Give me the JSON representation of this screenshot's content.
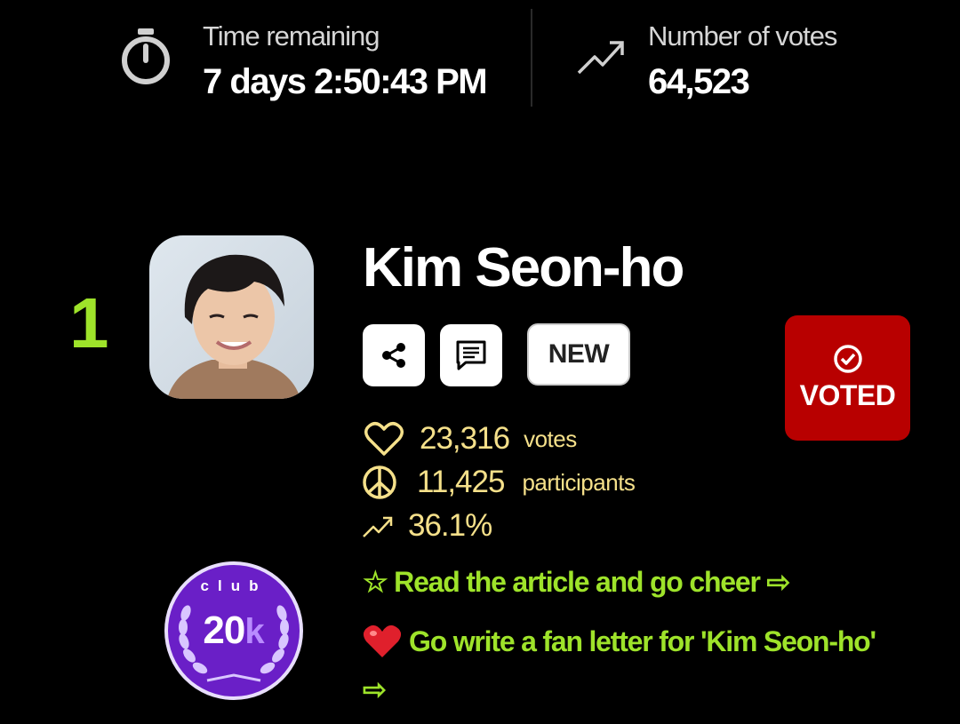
{
  "header": {
    "time_label": "Time remaining",
    "time_value": "7 days 2:50:43 PM",
    "votes_label": "Number of votes",
    "votes_value": "64,523"
  },
  "candidate": {
    "rank": "1",
    "name": "Kim Seon-ho",
    "new_badge": "NEW",
    "voted_label": "VOTED",
    "votes_count": "23,316",
    "votes_unit": "votes",
    "participants_count": "11,425",
    "participants_unit": "participants",
    "percentage": "36.1%"
  },
  "club_badge": {
    "top_text": "club",
    "value": "20",
    "suffix": "k"
  },
  "links": {
    "read_article": "☆ Read the article and go cheer ⇨",
    "fan_letter": "Go write a fan letter for 'Kim Seon-ho'",
    "fan_letter_arrow": "⇨"
  },
  "colors": {
    "accent_green": "#9ee32a",
    "stat_yellow": "#f5e08a",
    "voted_red": "#b80000",
    "club_purple": "#6a1fc7"
  }
}
